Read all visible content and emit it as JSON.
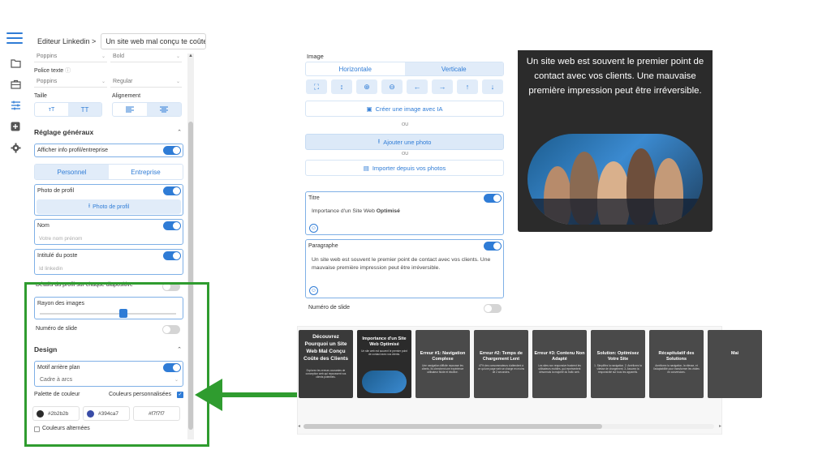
{
  "topbar": {
    "breadcrumb": "Editeur Linkedin >",
    "doc_title": "Un site web mal conçu te coûte d"
  },
  "panel": {
    "font_title": "Poppins",
    "font_title_weight": "Bold",
    "police_texte_label": "Police texte",
    "font_text": "Poppins",
    "font_text_weight": "Regular",
    "taille_label": "Taille",
    "alignement_label": "Alignement",
    "size_small": "ᴛT",
    "size_large": "TT",
    "reglage_title": "Réglage généraux",
    "afficher_info": "Afficher info profil/entreprise",
    "tab_personnel": "Personnel",
    "tab_entreprise": "Entreprise",
    "photo_profil_label": "Photo de profil",
    "photo_profil_button": "Photo de profil",
    "nom_label": "Nom",
    "nom_placeholder": "Votre nom prénom",
    "poste_label": "Intitulé du poste",
    "poste_placeholder": "Id linkedin",
    "details_label": "Détails du profil sur chaque diapositive",
    "rayon_label": "Rayon des images",
    "numero_slide": "Numéro de slide",
    "design_title": "Design",
    "motif_label": "Motif arrière plan",
    "motif_value": "Cadre à arcs",
    "palette_label": "Palette de couleur",
    "couleurs_perso": "Couleurs personnalisées",
    "colors": [
      {
        "hex_label": "#2b2b2b",
        "swatch": "#2b2b2b"
      },
      {
        "hex_label": "#394ca7",
        "swatch": "#394ca7"
      },
      {
        "hex_label": "#f7f7f7",
        "swatch": "#f7f7f7"
      }
    ],
    "couleurs_alternees": "Couleurs alternées"
  },
  "editor": {
    "image_label": "Image",
    "orient_h": "Horizontale",
    "orient_v": "Verticale",
    "create_ai": "Créer une image avec IA",
    "ou": "OU",
    "add_photo": "Ajouter une photo",
    "import_photos": "Importer depuis vos photos",
    "titre_label": "Titre",
    "titre_text_plain": "Importance d'un Site Web ",
    "titre_text_bold": "Optimisé",
    "paragraphe_label": "Paragraphe",
    "paragraphe_text": "Un site web est souvent le premier point de contact avec vos clients. Une mauvaise première impression peut être irréversible.",
    "numero_slide": "Numéro de slide"
  },
  "preview": {
    "text": "Un site web est souvent le premier point de contact avec vos clients. Une mauvaise première impression peut être irréversible."
  },
  "slides": [
    {
      "title": "Découvrez Pourquoi un Site Web Mal Conçu Coûte des Clients",
      "body": "Explorez les erreurs courantes de conception web qui repoussent vos clients potentiels."
    },
    {
      "title": "Importance d'un Site Web Optimisé",
      "body": "Un site web est souvent le premier point de contact avec vos clients."
    },
    {
      "title": "Erreur #1: Navigation Complexe",
      "body": "Une navigation difficile repousse les clients. Ils cherchent une expérience utilisateur fluide et intuitive."
    },
    {
      "title": "Erreur #2: Temps de Chargement Lent",
      "body": "47% des consommateurs s'attendent à ce qu'une page web se charge en moins de 2 secondes."
    },
    {
      "title": "Erreur #3: Contenu Non Adapté",
      "body": "Les sites non responsive frustrent les utilisateurs mobiles, qui représentent désormais la majorité du trafic web."
    },
    {
      "title": "Solution: Optimisez Votre Site",
      "body": "1. Simplifiez la navigation. 2. Améliorez la vitesse de chargement. 3. Assurez la responsivité sur tous les appareils."
    },
    {
      "title": "Récapitulatif des Solutions",
      "body": "Améliorez la navigation, la vitesse, et l'adaptabilité pour transformer les visites en conversions."
    },
    {
      "title": "Mai",
      "body": ""
    }
  ]
}
